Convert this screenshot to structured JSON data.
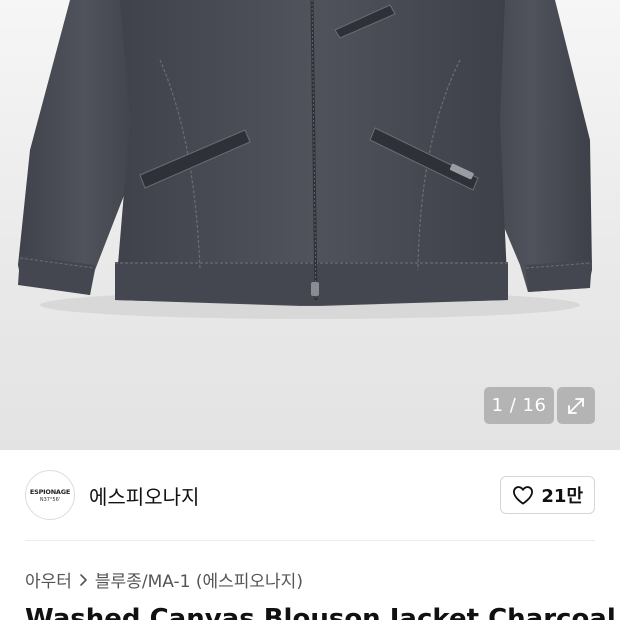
{
  "gallery": {
    "image_alt": "Washed Canvas Blouson Jacket Charcoal",
    "counter": "1 / 16",
    "expand_icon": "expand-arrows-icon"
  },
  "brand": {
    "logo_line1": "ESPIONAGE",
    "logo_line2": "N37°56'",
    "name": "에스피오나지"
  },
  "like": {
    "icon": "heart-outline-icon",
    "count": "21만"
  },
  "breadcrumb": {
    "items": [
      "아우터",
      "블루종/MA-1 (에스피오나지)"
    ],
    "separator_icon": "chevron-right-icon"
  },
  "product": {
    "title": "Washed Canvas Blouson Jacket Charcoal N"
  },
  "colors": {
    "jacket": "#4a4d55",
    "background": "#ececec",
    "overlay": "rgba(140,140,140,0.55)"
  }
}
